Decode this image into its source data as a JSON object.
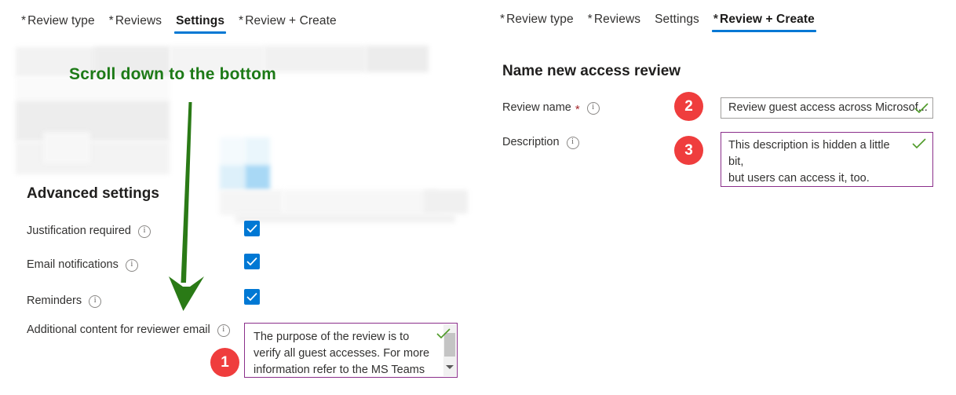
{
  "left_panel": {
    "tabs": [
      {
        "label": "Review type",
        "required": true,
        "active": false
      },
      {
        "label": "Reviews",
        "required": true,
        "active": false
      },
      {
        "label": "Settings",
        "required": false,
        "active": true
      },
      {
        "label": "Review + Create",
        "required": true,
        "active": false
      }
    ],
    "annotation": "Scroll down to the bottom",
    "annotation_color": "#1d7a17",
    "advanced_settings_heading": "Advanced settings",
    "settings": [
      {
        "label": "Justification required",
        "checked": true
      },
      {
        "label": "Email notifications",
        "checked": true
      },
      {
        "label": "Reminders",
        "checked": true
      }
    ],
    "reviewer_email": {
      "label": "Additional content for reviewer email",
      "value": "The purpose of the review is to\nverify all guest accesses. For more\ninformation refer to the MS Teams",
      "border_color": "#8b2f8b",
      "valid": true
    }
  },
  "right_panel": {
    "tabs": [
      {
        "label": "Review type",
        "required": true,
        "active": false
      },
      {
        "label": "Reviews",
        "required": true,
        "active": false
      },
      {
        "label": "Settings",
        "required": false,
        "active": false
      },
      {
        "label": "Review + Create",
        "required": true,
        "active": true
      }
    ],
    "heading": "Name new access review",
    "review_name": {
      "label": "Review name",
      "required_marker": "*",
      "value": "Review guest access across Microsof...",
      "border_color": "#a19f9d",
      "valid": true
    },
    "description": {
      "label": "Description",
      "value": "This description is hidden a little bit,\nbut users can access it, too.",
      "border_color": "#8b2f8b",
      "valid": true
    }
  },
  "badges": [
    {
      "number": "1"
    },
    {
      "number": "2"
    },
    {
      "number": "3"
    }
  ],
  "colors": {
    "accent_blue": "#0078d4",
    "badge_red": "#ef3d3d",
    "annotation_green": "#1d7a17",
    "valid_check_green": "#4e9a28",
    "field_purple": "#8b2f8b"
  }
}
